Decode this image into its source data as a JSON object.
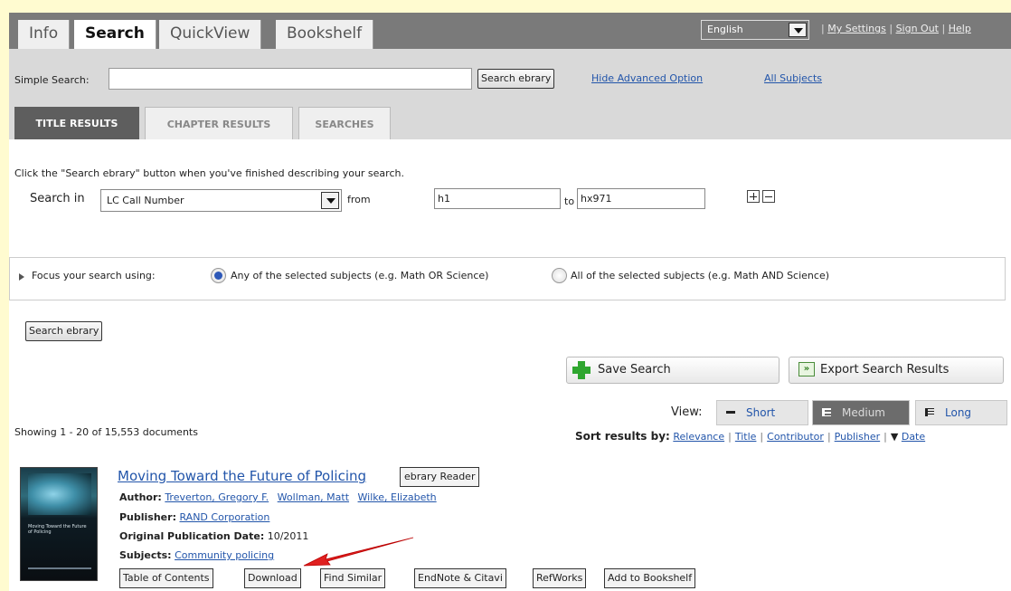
{
  "tabs": [
    "Info",
    "Search",
    "QuickView",
    "Bookshelf"
  ],
  "header": {
    "language": "English",
    "links": [
      "My Settings",
      "Sign Out",
      "Help"
    ],
    "separator": "|"
  },
  "search": {
    "simple_label": "Simple Search:",
    "simple_value": "",
    "button_label": "Search ebrary",
    "hide_advanced": "Hide Advanced Option",
    "all_subjects": "All Subjects"
  },
  "result_tabs": [
    "TITLE RESULTS",
    "CHAPTER RESULTS",
    "SEARCHES"
  ],
  "advanced": {
    "hint": "Click the \"Search ebrary\" button when you've finished describing your search.",
    "search_in_label": "Search in",
    "field": "LC Call Number",
    "from_label": "from",
    "from_value": "h1",
    "to_label": "to",
    "to_value": "hx971"
  },
  "focus": {
    "label": "Focus your search using:",
    "any_label": "Any of the selected subjects (e.g. Math OR Science)",
    "all_label": "All of the selected subjects (e.g. Math AND Science)",
    "selected": "any"
  },
  "search_button2": "Search ebrary",
  "actions": {
    "save": "Save Search",
    "export": "Export Search Results"
  },
  "view": {
    "label": "View:",
    "options": [
      "Short",
      "Medium",
      "Long"
    ],
    "active": "Medium"
  },
  "showing": "Showing 1 - 20 of 15,553 documents",
  "sort": {
    "label": "Sort results by:",
    "options": [
      "Relevance",
      "Title",
      "Contributor",
      "Publisher",
      "Date"
    ]
  },
  "result": {
    "title": "Moving Toward the Future of Policing",
    "reader_button": "ebrary Reader",
    "author_label": "Author:",
    "authors": [
      "Treverton, Gregory F.",
      "Wollman, Matt",
      "Wilke, Elizabeth"
    ],
    "publisher_label": "Publisher:",
    "publisher": "RAND Corporation",
    "date_label": "Original Publication Date:",
    "date": "10/2011",
    "subjects_label": "Subjects:",
    "subject": "Community policing",
    "cover_title": "Moving Toward the Future of Policing",
    "buttons": [
      "Table of Contents",
      "Download",
      "Find Similar",
      "EndNote & Citavi",
      "RefWorks",
      "Add to Bookshelf"
    ]
  },
  "colors": {
    "page_bg": "#fffbd0",
    "topbar": "#7a7a7a",
    "search_strip": "#d9d9d9",
    "link": "#2255aa",
    "annotation_arrow": "#e02020"
  }
}
